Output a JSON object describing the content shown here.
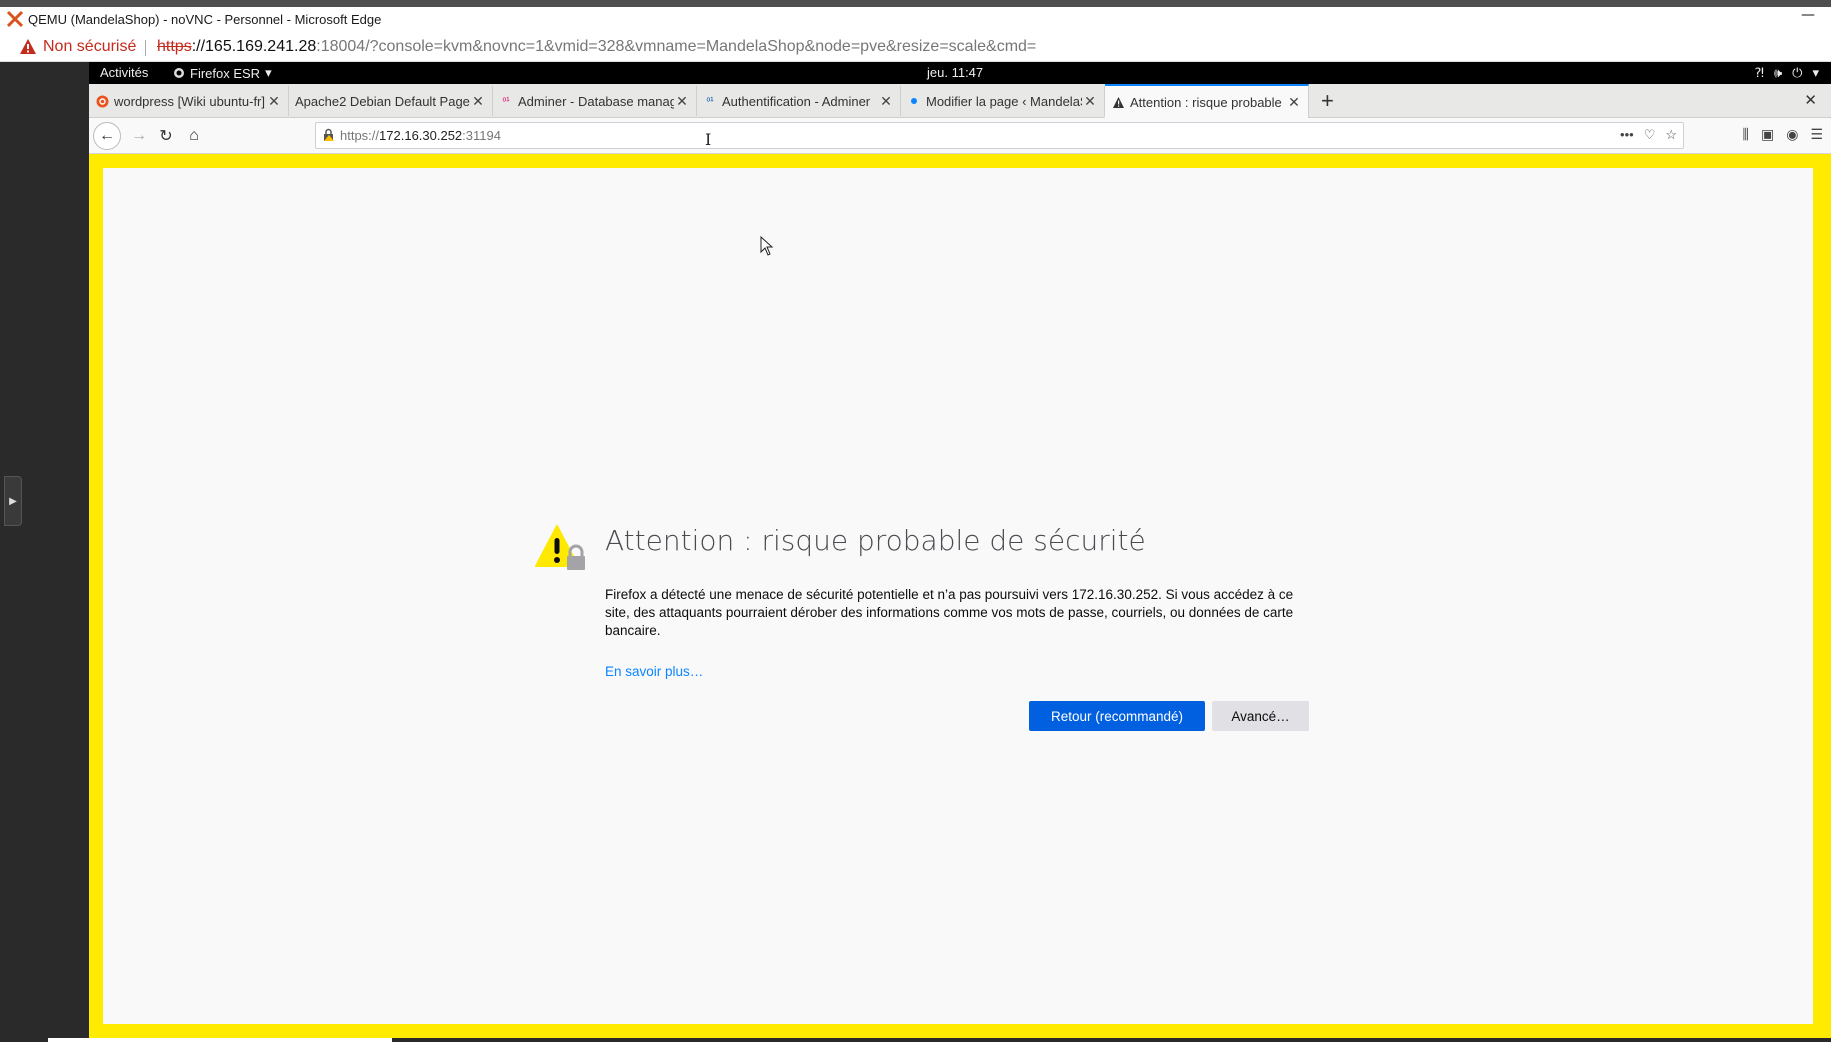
{
  "edge": {
    "window_title": "QEMU (MandelaShop) - noVNC - Personnel - Microsoft Edge",
    "minimize_glyph": "—",
    "not_secure_label": "Non sécurisé",
    "url_scheme": "https",
    "url_host": "://165.169.241.28",
    "url_rest": ":18004/?console=kvm&novnc=1&vmid=328&vmname=MandelaShop&node=pve&resize=scale&cmd="
  },
  "gnome": {
    "activities": "Activités",
    "app_name": "Firefox ESR",
    "clock": "jeu. 11:47"
  },
  "firefox": {
    "tabs": [
      {
        "title": "wordpress [Wiki ubuntu-fr]",
        "favicon": "ubuntu-icon"
      },
      {
        "title": "Apache2 Debian Default Page",
        "favicon": "none"
      },
      {
        "title": "Adminer - Database management",
        "favicon": "adminer-icon"
      },
      {
        "title": "Authentification - Adminer",
        "favicon": "adminer-icon"
      },
      {
        "title": "Modifier la page ‹ MandelaShop",
        "favicon": "dot-icon"
      },
      {
        "title": "Attention : risque probable de sécurité",
        "favicon": "warning-icon"
      }
    ],
    "url_scheme": "https://",
    "url_host": "172.16.30.252",
    "url_port": ":31194"
  },
  "error_page": {
    "title": "Attention : risque probable de sécurité",
    "description": "Firefox a détecté une menace de sécurité potentielle et n’a pas poursuivi vers 172.16.30.252. Si vous accédez à ce site, des attaquants pourraient dérober des informations comme vos mots de passe, courriels, ou données de carte bancaire.",
    "learn_more": "En savoir plus…",
    "back_button": "Retour (recommandé)",
    "advanced_button": "Avancé…"
  },
  "colors": {
    "frame_yellow": "#ffeb00",
    "primary_button": "#0060df",
    "link": "#0a84ff",
    "not_secure_red": "#c42b1c"
  }
}
